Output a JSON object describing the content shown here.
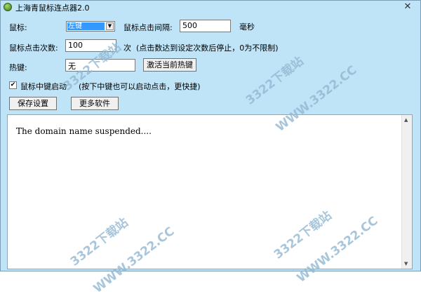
{
  "window": {
    "title": "上海青鼠标连点器2.0",
    "close_glyph": "✕"
  },
  "form": {
    "mouse_label": "鼠标:",
    "mouse_selected": "左键",
    "interval_label": "鼠标点击间隔:",
    "interval_value": "500",
    "interval_unit": "毫秒",
    "count_label": "鼠标点击次数:",
    "count_value": "100",
    "count_unit": "次",
    "count_hint": "(点击数达到设定次数后停止，0为不限制)",
    "hotkey_label": "热键:",
    "hotkey_value": "无",
    "activate_hotkey_button": "激活当前热键",
    "middle_click_checked": true,
    "middle_click_label": "鼠标中键启动",
    "middle_click_hint": "(按下中键也可以启动点击，更快捷)",
    "save_button": "保存设置",
    "more_software_button": "更多软件"
  },
  "content": {
    "text": "The domain name suspended...."
  },
  "watermark": {
    "text_site": "3322下载站",
    "text_url": "WWW.3322.CC"
  },
  "icons": {
    "app": "app-icon",
    "close": "close-icon",
    "dropdown": "chevron-down-icon",
    "check": "checkmark-icon",
    "scroll_up": "scroll-up-arrow-icon",
    "scroll_down": "scroll-down-arrow-icon"
  },
  "colors": {
    "window_bg": "#bfe3f7",
    "selection": "#3399ff",
    "watermark": "#93b9d3"
  }
}
